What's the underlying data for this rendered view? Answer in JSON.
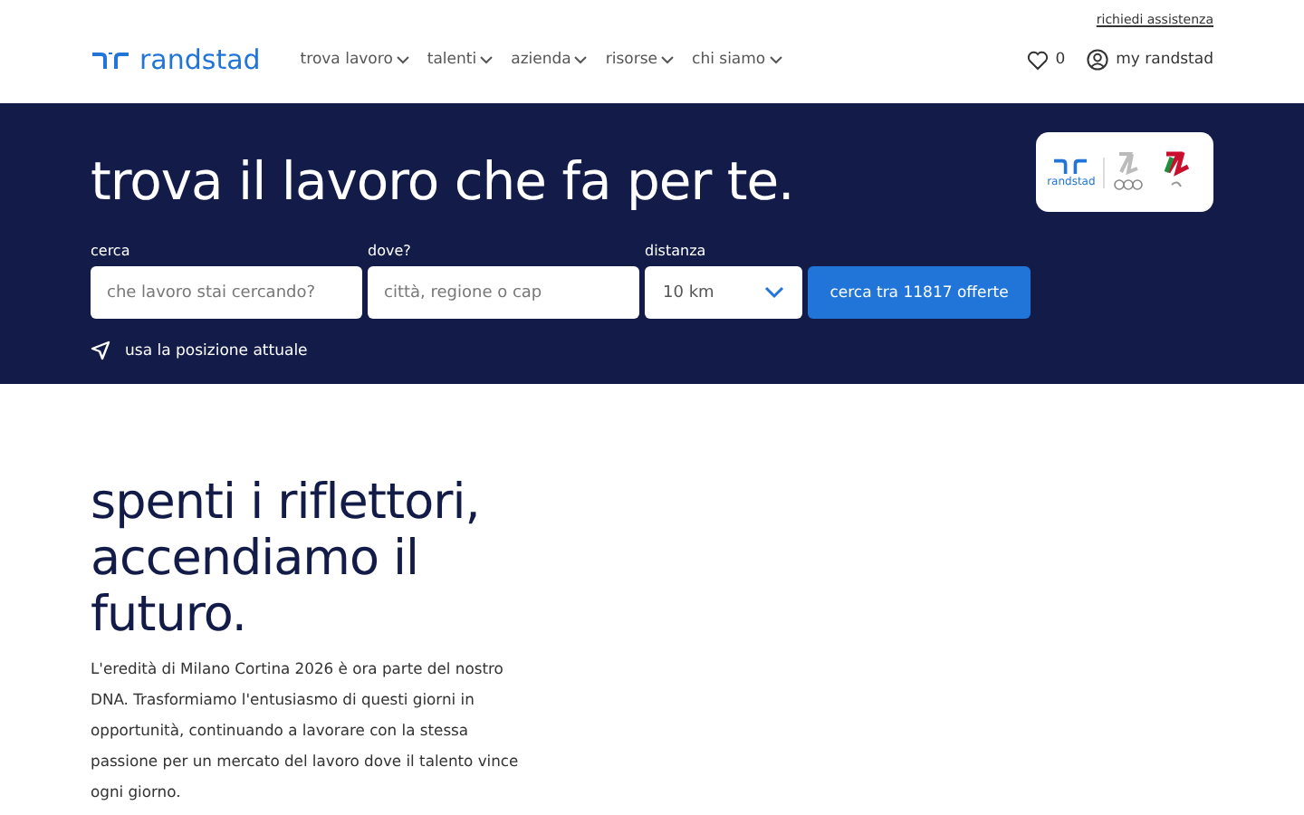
{
  "header": {
    "help_link": "richiedi assistenza",
    "logo": "randstad",
    "nav": [
      {
        "label": "trova lavoro"
      },
      {
        "label": "talenti"
      },
      {
        "label": "azienda"
      },
      {
        "label": "risorse"
      },
      {
        "label": "chi siamo"
      }
    ],
    "favorites_count": "0",
    "account": "my randstad"
  },
  "hero": {
    "title": "trova il lavoro che fa per te.",
    "badge_logo": "randstad",
    "fields": [
      {
        "kind": "text",
        "label": "cerca",
        "placeholder": "che lavoro stai cercando?"
      },
      {
        "kind": "text",
        "label": "dove?",
        "placeholder": "città, regione o cap"
      },
      {
        "kind": "select",
        "label": "distanza",
        "value": "10 km"
      }
    ],
    "search_button": "cerca tra 11817 offerte",
    "location_link": "usa la posizione attuale"
  },
  "promo": {
    "headline": "spenti i riflettori, accendiamo il futuro.",
    "body": "L'eredità di Milano Cortina 2026 è ora parte del nostro DNA. Trasformiamo l'entusiasmo di questi giorni in opportunità, continuando a lavorare con la stessa passione per un mercato del lavoro dove il talento vince ogni giorno."
  }
}
